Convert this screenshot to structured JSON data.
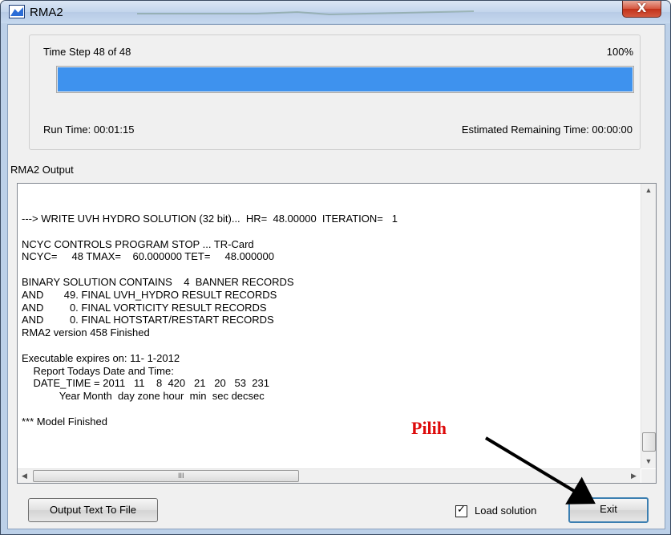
{
  "window": {
    "title": "RMA2",
    "close_label": "X"
  },
  "progress": {
    "step_text": "Time Step 48 of 48",
    "percent_text": "100%",
    "fraction": 1.0,
    "run_time": "Run Time: 00:01:15",
    "remaining": "Estimated Remaining Time: 00:00:00",
    "bar_color": "#3e92ee"
  },
  "output": {
    "label": "RMA2 Output",
    "text": "---> WRITE UVH HYDRO SOLUTION (32 bit)...  HR=  48.00000  ITERATION=   1\n\nNCYC CONTROLS PROGRAM STOP ... TR-Card\nNCYC=     48 TMAX=    60.000000 TET=     48.000000\n\nBINARY SOLUTION CONTAINS    4  BANNER RECORDS\nAND       49. FINAL UVH_HYDRO RESULT RECORDS\nAND         0. FINAL VORTICITY RESULT RECORDS\nAND         0. FINAL HOTSTART/RESTART RECORDS\nRMA2 version 458 Finished\n\nExecutable expires on: 11- 1-2012\n    Report Todays Date and Time:\n    DATE_TIME = 2011   11    8  420   21   20   53  231\n             Year Month  day zone hour  min  sec decsec\n\n*** Model Finished",
    "hscroll_grip": "III"
  },
  "buttons": {
    "output_to_file": "Output Text To File",
    "exit": "Exit"
  },
  "load_solution": {
    "label": "Load solution",
    "checked": true
  },
  "annotation": {
    "text": "Pilih",
    "color": "#dd0a0a"
  }
}
